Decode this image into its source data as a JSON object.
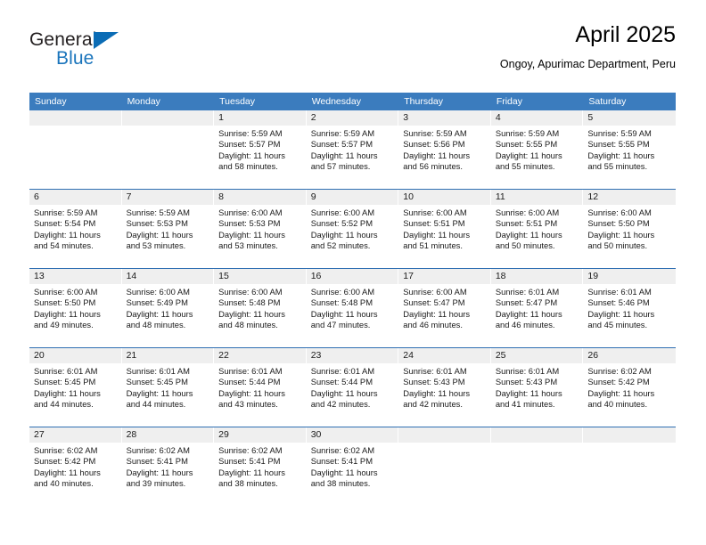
{
  "logo": {
    "line1": "General",
    "line2": "Blue",
    "triangle_icon": "triangle-icon",
    "colors": {
      "general_text": "#231f20",
      "blue_text": "#1b75bc",
      "triangle": "#0b6cb5"
    }
  },
  "header": {
    "month_title": "April 2025",
    "location": "Ongoy, Apurimac Department, Peru"
  },
  "theme": {
    "header_blue": "#3b7cbe",
    "row_divider_blue": "#2f6fb2",
    "day_band_gray": "#efefef",
    "text": "#1a1a1a"
  },
  "calendar": {
    "weekdays": [
      "Sunday",
      "Monday",
      "Tuesday",
      "Wednesday",
      "Thursday",
      "Friday",
      "Saturday"
    ],
    "weeks": [
      [
        {
          "day": "",
          "sunrise": "",
          "sunset": "",
          "daylight_line1": "",
          "daylight_line2": ""
        },
        {
          "day": "",
          "sunrise": "",
          "sunset": "",
          "daylight_line1": "",
          "daylight_line2": ""
        },
        {
          "day": "1",
          "sunrise": "Sunrise: 5:59 AM",
          "sunset": "Sunset: 5:57 PM",
          "daylight_line1": "Daylight: 11 hours",
          "daylight_line2": "and 58 minutes."
        },
        {
          "day": "2",
          "sunrise": "Sunrise: 5:59 AM",
          "sunset": "Sunset: 5:57 PM",
          "daylight_line1": "Daylight: 11 hours",
          "daylight_line2": "and 57 minutes."
        },
        {
          "day": "3",
          "sunrise": "Sunrise: 5:59 AM",
          "sunset": "Sunset: 5:56 PM",
          "daylight_line1": "Daylight: 11 hours",
          "daylight_line2": "and 56 minutes."
        },
        {
          "day": "4",
          "sunrise": "Sunrise: 5:59 AM",
          "sunset": "Sunset: 5:55 PM",
          "daylight_line1": "Daylight: 11 hours",
          "daylight_line2": "and 55 minutes."
        },
        {
          "day": "5",
          "sunrise": "Sunrise: 5:59 AM",
          "sunset": "Sunset: 5:55 PM",
          "daylight_line1": "Daylight: 11 hours",
          "daylight_line2": "and 55 minutes."
        }
      ],
      [
        {
          "day": "6",
          "sunrise": "Sunrise: 5:59 AM",
          "sunset": "Sunset: 5:54 PM",
          "daylight_line1": "Daylight: 11 hours",
          "daylight_line2": "and 54 minutes."
        },
        {
          "day": "7",
          "sunrise": "Sunrise: 5:59 AM",
          "sunset": "Sunset: 5:53 PM",
          "daylight_line1": "Daylight: 11 hours",
          "daylight_line2": "and 53 minutes."
        },
        {
          "day": "8",
          "sunrise": "Sunrise: 6:00 AM",
          "sunset": "Sunset: 5:53 PM",
          "daylight_line1": "Daylight: 11 hours",
          "daylight_line2": "and 53 minutes."
        },
        {
          "day": "9",
          "sunrise": "Sunrise: 6:00 AM",
          "sunset": "Sunset: 5:52 PM",
          "daylight_line1": "Daylight: 11 hours",
          "daylight_line2": "and 52 minutes."
        },
        {
          "day": "10",
          "sunrise": "Sunrise: 6:00 AM",
          "sunset": "Sunset: 5:51 PM",
          "daylight_line1": "Daylight: 11 hours",
          "daylight_line2": "and 51 minutes."
        },
        {
          "day": "11",
          "sunrise": "Sunrise: 6:00 AM",
          "sunset": "Sunset: 5:51 PM",
          "daylight_line1": "Daylight: 11 hours",
          "daylight_line2": "and 50 minutes."
        },
        {
          "day": "12",
          "sunrise": "Sunrise: 6:00 AM",
          "sunset": "Sunset: 5:50 PM",
          "daylight_line1": "Daylight: 11 hours",
          "daylight_line2": "and 50 minutes."
        }
      ],
      [
        {
          "day": "13",
          "sunrise": "Sunrise: 6:00 AM",
          "sunset": "Sunset: 5:50 PM",
          "daylight_line1": "Daylight: 11 hours",
          "daylight_line2": "and 49 minutes."
        },
        {
          "day": "14",
          "sunrise": "Sunrise: 6:00 AM",
          "sunset": "Sunset: 5:49 PM",
          "daylight_line1": "Daylight: 11 hours",
          "daylight_line2": "and 48 minutes."
        },
        {
          "day": "15",
          "sunrise": "Sunrise: 6:00 AM",
          "sunset": "Sunset: 5:48 PM",
          "daylight_line1": "Daylight: 11 hours",
          "daylight_line2": "and 48 minutes."
        },
        {
          "day": "16",
          "sunrise": "Sunrise: 6:00 AM",
          "sunset": "Sunset: 5:48 PM",
          "daylight_line1": "Daylight: 11 hours",
          "daylight_line2": "and 47 minutes."
        },
        {
          "day": "17",
          "sunrise": "Sunrise: 6:00 AM",
          "sunset": "Sunset: 5:47 PM",
          "daylight_line1": "Daylight: 11 hours",
          "daylight_line2": "and 46 minutes."
        },
        {
          "day": "18",
          "sunrise": "Sunrise: 6:01 AM",
          "sunset": "Sunset: 5:47 PM",
          "daylight_line1": "Daylight: 11 hours",
          "daylight_line2": "and 46 minutes."
        },
        {
          "day": "19",
          "sunrise": "Sunrise: 6:01 AM",
          "sunset": "Sunset: 5:46 PM",
          "daylight_line1": "Daylight: 11 hours",
          "daylight_line2": "and 45 minutes."
        }
      ],
      [
        {
          "day": "20",
          "sunrise": "Sunrise: 6:01 AM",
          "sunset": "Sunset: 5:45 PM",
          "daylight_line1": "Daylight: 11 hours",
          "daylight_line2": "and 44 minutes."
        },
        {
          "day": "21",
          "sunrise": "Sunrise: 6:01 AM",
          "sunset": "Sunset: 5:45 PM",
          "daylight_line1": "Daylight: 11 hours",
          "daylight_line2": "and 44 minutes."
        },
        {
          "day": "22",
          "sunrise": "Sunrise: 6:01 AM",
          "sunset": "Sunset: 5:44 PM",
          "daylight_line1": "Daylight: 11 hours",
          "daylight_line2": "and 43 minutes."
        },
        {
          "day": "23",
          "sunrise": "Sunrise: 6:01 AM",
          "sunset": "Sunset: 5:44 PM",
          "daylight_line1": "Daylight: 11 hours",
          "daylight_line2": "and 42 minutes."
        },
        {
          "day": "24",
          "sunrise": "Sunrise: 6:01 AM",
          "sunset": "Sunset: 5:43 PM",
          "daylight_line1": "Daylight: 11 hours",
          "daylight_line2": "and 42 minutes."
        },
        {
          "day": "25",
          "sunrise": "Sunrise: 6:01 AM",
          "sunset": "Sunset: 5:43 PM",
          "daylight_line1": "Daylight: 11 hours",
          "daylight_line2": "and 41 minutes."
        },
        {
          "day": "26",
          "sunrise": "Sunrise: 6:02 AM",
          "sunset": "Sunset: 5:42 PM",
          "daylight_line1": "Daylight: 11 hours",
          "daylight_line2": "and 40 minutes."
        }
      ],
      [
        {
          "day": "27",
          "sunrise": "Sunrise: 6:02 AM",
          "sunset": "Sunset: 5:42 PM",
          "daylight_line1": "Daylight: 11 hours",
          "daylight_line2": "and 40 minutes."
        },
        {
          "day": "28",
          "sunrise": "Sunrise: 6:02 AM",
          "sunset": "Sunset: 5:41 PM",
          "daylight_line1": "Daylight: 11 hours",
          "daylight_line2": "and 39 minutes."
        },
        {
          "day": "29",
          "sunrise": "Sunrise: 6:02 AM",
          "sunset": "Sunset: 5:41 PM",
          "daylight_line1": "Daylight: 11 hours",
          "daylight_line2": "and 38 minutes."
        },
        {
          "day": "30",
          "sunrise": "Sunrise: 6:02 AM",
          "sunset": "Sunset: 5:41 PM",
          "daylight_line1": "Daylight: 11 hours",
          "daylight_line2": "and 38 minutes."
        },
        {
          "day": "",
          "sunrise": "",
          "sunset": "",
          "daylight_line1": "",
          "daylight_line2": ""
        },
        {
          "day": "",
          "sunrise": "",
          "sunset": "",
          "daylight_line1": "",
          "daylight_line2": ""
        },
        {
          "day": "",
          "sunrise": "",
          "sunset": "",
          "daylight_line1": "",
          "daylight_line2": ""
        }
      ]
    ]
  }
}
